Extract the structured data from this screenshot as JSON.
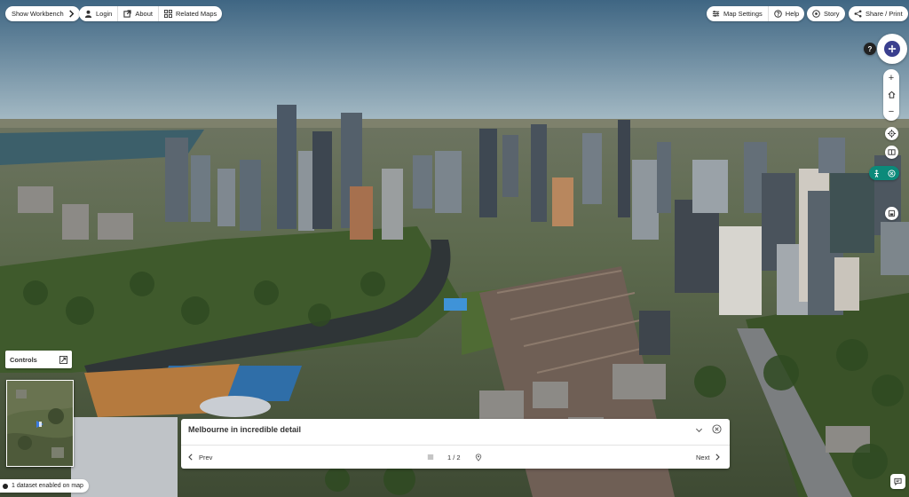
{
  "app": {
    "topbar_left": {
      "workbench": "Show Workbench",
      "login": "Login",
      "about": "About",
      "related_maps": "Related Maps"
    },
    "topbar_right": {
      "map_settings": "Map Settings",
      "help": "Help",
      "story": "Story",
      "share_print": "Share / Print"
    },
    "help_mark": "?",
    "zoom": {
      "in": "+",
      "out": "−"
    }
  },
  "controls_panel": {
    "label": "Controls"
  },
  "story_panel": {
    "title": "Melbourne in incredible detail",
    "prev": "Prev",
    "next": "Next",
    "counter": "1 / 2"
  },
  "status": {
    "datasets": "1 dataset enabled on map"
  },
  "colors": {
    "accent": "#0b8a7a",
    "compass": "#3a3f8f",
    "sky_top": "#4a6f8e",
    "sky_bottom": "#9fb7c4"
  },
  "icons": [
    "chevron-right-icon",
    "user-icon",
    "external-link-icon",
    "grid-icon",
    "sliders-icon",
    "help-circle-icon",
    "story-icon",
    "share-icon",
    "compass-icon",
    "home-icon",
    "locate-icon",
    "split-view-icon",
    "pedestrian-icon",
    "close-icon",
    "chevron-down-icon",
    "list-icon",
    "location-pin-icon",
    "chevron-left-icon",
    "expand-icon",
    "chat-icon"
  ]
}
